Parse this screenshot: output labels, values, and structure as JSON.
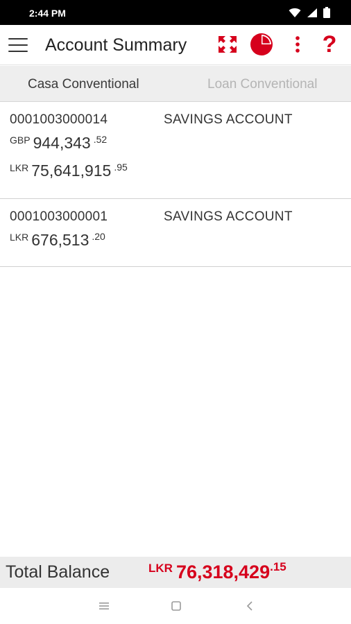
{
  "status_bar": {
    "time": "2:44 PM",
    "icons": [
      "wifi-icon",
      "signal-icon",
      "battery-icon"
    ]
  },
  "app_bar": {
    "title": "Account Summary",
    "icons": [
      "menu-icon",
      "expand-icon",
      "pie-chart-icon",
      "more-vert-icon",
      "help-icon"
    ],
    "help_glyph": "?"
  },
  "tabs": [
    {
      "label": "Casa Conventional",
      "selected": true
    },
    {
      "label": "Loan Conventional",
      "selected": false
    }
  ],
  "accounts": [
    {
      "number": "0001003000014",
      "type": "SAVINGS ACCOUNT",
      "balances": [
        {
          "currency": "GBP",
          "amount": "944,343",
          "decimals": ".52"
        },
        {
          "currency": "LKR",
          "amount": "75,641,915",
          "decimals": ".95"
        }
      ]
    },
    {
      "number": "0001003000001",
      "type": "SAVINGS ACCOUNT",
      "balances": [
        {
          "currency": "LKR",
          "amount": "676,513",
          "decimals": ".20"
        }
      ]
    }
  ],
  "total": {
    "label": "Total Balance",
    "currency": "LKR",
    "amount": "76,318,429",
    "decimals": ".15"
  },
  "nav_bar": {
    "icons": [
      "recents-icon",
      "home-icon",
      "back-icon"
    ]
  },
  "colors": {
    "accent": "#d6001c",
    "status_bar": "#000000",
    "tab_strip": "#eeeeee",
    "total_bar": "#ececec",
    "inactive_tab": "#b4b4b4"
  }
}
